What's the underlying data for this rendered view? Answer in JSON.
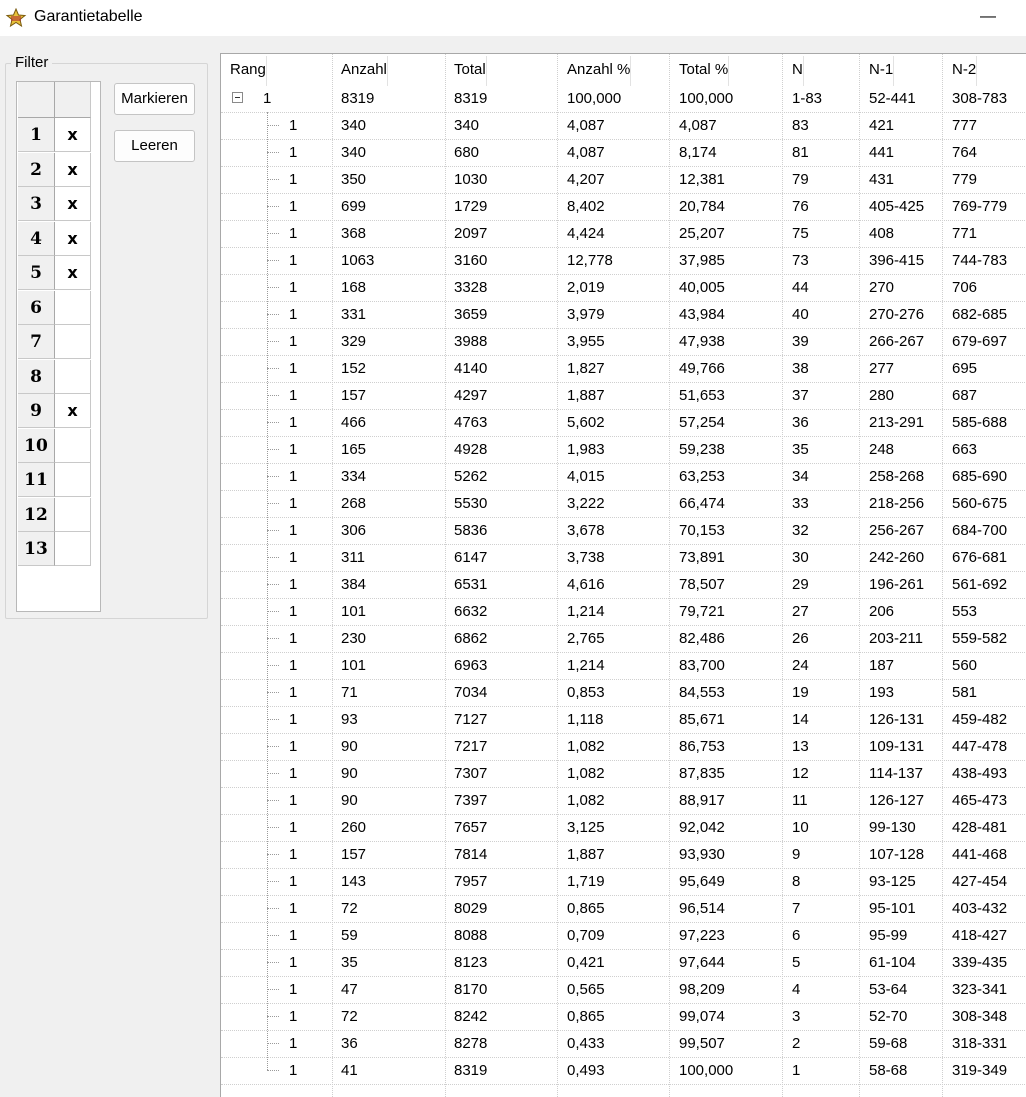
{
  "window": {
    "title": "Garantietabelle",
    "minimize_glyph": "—"
  },
  "filter": {
    "legend": "Filter",
    "rows": [
      {
        "num": "1",
        "mark": "x"
      },
      {
        "num": "2",
        "mark": "x"
      },
      {
        "num": "3",
        "mark": "x"
      },
      {
        "num": "4",
        "mark": "x"
      },
      {
        "num": "5",
        "mark": "x"
      },
      {
        "num": "6",
        "mark": ""
      },
      {
        "num": "7",
        "mark": ""
      },
      {
        "num": "8",
        "mark": ""
      },
      {
        "num": "9",
        "mark": "x"
      },
      {
        "num": "10",
        "mark": ""
      },
      {
        "num": "11",
        "mark": ""
      },
      {
        "num": "12",
        "mark": ""
      },
      {
        "num": "13",
        "mark": ""
      }
    ],
    "mark_button": "Markieren",
    "clear_button": "Leeren"
  },
  "table": {
    "headers": [
      "Rang",
      "Anzahl",
      "Total",
      "Anzahl %",
      "Total %",
      "N",
      "N-1",
      "N-2"
    ],
    "root": [
      "1",
      "8319",
      "8319",
      "100,000",
      "100,000",
      "1-83",
      "52-441",
      "308-783"
    ],
    "rows": [
      [
        "1",
        "340",
        "340",
        "4,087",
        "4,087",
        "83",
        "421",
        "777"
      ],
      [
        "1",
        "340",
        "680",
        "4,087",
        "8,174",
        "81",
        "441",
        "764"
      ],
      [
        "1",
        "350",
        "1030",
        "4,207",
        "12,381",
        "79",
        "431",
        "779"
      ],
      [
        "1",
        "699",
        "1729",
        "8,402",
        "20,784",
        "76",
        "405-425",
        "769-779"
      ],
      [
        "1",
        "368",
        "2097",
        "4,424",
        "25,207",
        "75",
        "408",
        "771"
      ],
      [
        "1",
        "1063",
        "3160",
        "12,778",
        "37,985",
        "73",
        "396-415",
        "744-783"
      ],
      [
        "1",
        "168",
        "3328",
        "2,019",
        "40,005",
        "44",
        "270",
        "706"
      ],
      [
        "1",
        "331",
        "3659",
        "3,979",
        "43,984",
        "40",
        "270-276",
        "682-685"
      ],
      [
        "1",
        "329",
        "3988",
        "3,955",
        "47,938",
        "39",
        "266-267",
        "679-697"
      ],
      [
        "1",
        "152",
        "4140",
        "1,827",
        "49,766",
        "38",
        "277",
        "695"
      ],
      [
        "1",
        "157",
        "4297",
        "1,887",
        "51,653",
        "37",
        "280",
        "687"
      ],
      [
        "1",
        "466",
        "4763",
        "5,602",
        "57,254",
        "36",
        "213-291",
        "585-688"
      ],
      [
        "1",
        "165",
        "4928",
        "1,983",
        "59,238",
        "35",
        "248",
        "663"
      ],
      [
        "1",
        "334",
        "5262",
        "4,015",
        "63,253",
        "34",
        "258-268",
        "685-690"
      ],
      [
        "1",
        "268",
        "5530",
        "3,222",
        "66,474",
        "33",
        "218-256",
        "560-675"
      ],
      [
        "1",
        "306",
        "5836",
        "3,678",
        "70,153",
        "32",
        "256-267",
        "684-700"
      ],
      [
        "1",
        "311",
        "6147",
        "3,738",
        "73,891",
        "30",
        "242-260",
        "676-681"
      ],
      [
        "1",
        "384",
        "6531",
        "4,616",
        "78,507",
        "29",
        "196-261",
        "561-692"
      ],
      [
        "1",
        "101",
        "6632",
        "1,214",
        "79,721",
        "27",
        "206",
        "553"
      ],
      [
        "1",
        "230",
        "6862",
        "2,765",
        "82,486",
        "26",
        "203-211",
        "559-582"
      ],
      [
        "1",
        "101",
        "6963",
        "1,214",
        "83,700",
        "24",
        "187",
        "560"
      ],
      [
        "1",
        "71",
        "7034",
        "0,853",
        "84,553",
        "19",
        "193",
        "581"
      ],
      [
        "1",
        "93",
        "7127",
        "1,118",
        "85,671",
        "14",
        "126-131",
        "459-482"
      ],
      [
        "1",
        "90",
        "7217",
        "1,082",
        "86,753",
        "13",
        "109-131",
        "447-478"
      ],
      [
        "1",
        "90",
        "7307",
        "1,082",
        "87,835",
        "12",
        "114-137",
        "438-493"
      ],
      [
        "1",
        "90",
        "7397",
        "1,082",
        "88,917",
        "11",
        "126-127",
        "465-473"
      ],
      [
        "1",
        "260",
        "7657",
        "3,125",
        "92,042",
        "10",
        "99-130",
        "428-481"
      ],
      [
        "1",
        "157",
        "7814",
        "1,887",
        "93,930",
        "9",
        "107-128",
        "441-468"
      ],
      [
        "1",
        "143",
        "7957",
        "1,719",
        "95,649",
        "8",
        "93-125",
        "427-454"
      ],
      [
        "1",
        "72",
        "8029",
        "0,865",
        "96,514",
        "7",
        "95-101",
        "403-432"
      ],
      [
        "1",
        "59",
        "8088",
        "0,709",
        "97,223",
        "6",
        "95-99",
        "418-427"
      ],
      [
        "1",
        "35",
        "8123",
        "0,421",
        "97,644",
        "5",
        "61-104",
        "339-435"
      ],
      [
        "1",
        "47",
        "8170",
        "0,565",
        "98,209",
        "4",
        "53-64",
        "323-341"
      ],
      [
        "1",
        "72",
        "8242",
        "0,865",
        "99,074",
        "3",
        "52-70",
        "308-348"
      ],
      [
        "1",
        "36",
        "8278",
        "0,433",
        "99,507",
        "2",
        "59-68",
        "318-331"
      ],
      [
        "1",
        "41",
        "8319",
        "0,493",
        "100,000",
        "1",
        "58-68",
        "319-349"
      ]
    ]
  }
}
